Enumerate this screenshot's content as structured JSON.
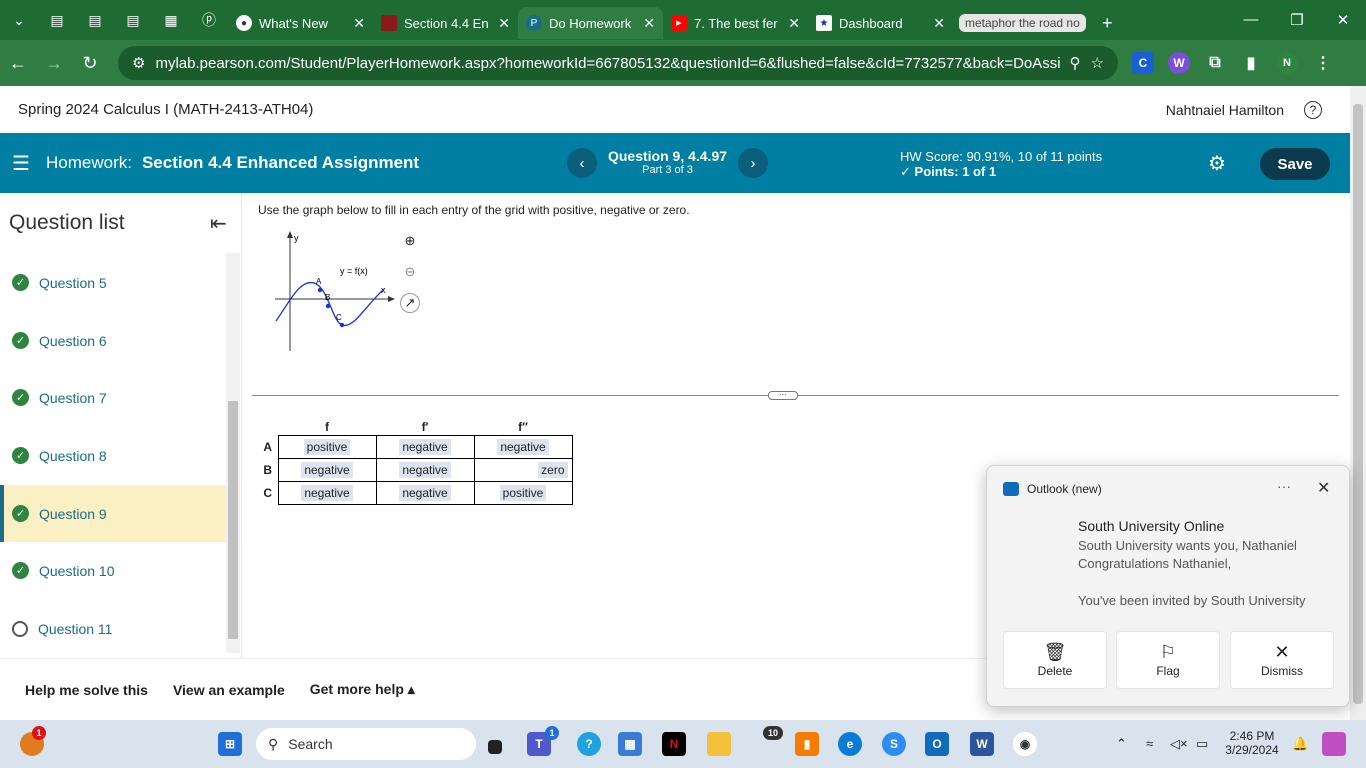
{
  "browser": {
    "tabs": [
      {
        "label": "What's New",
        "active": false
      },
      {
        "label": "Section 4.4 En",
        "active": false
      },
      {
        "label": "Do Homework",
        "active": true
      },
      {
        "label": "7. The best fer",
        "active": false
      },
      {
        "label": "Dashboard",
        "active": false
      },
      {
        "label": "metaphor the road no",
        "active": false
      }
    ],
    "new_tab": "+",
    "url": "mylab.pearson.com/Student/PlayerHomework.aspx?homeworkId=667805132&questionId=6&flushed=false&cId=7732577&back=DoAssignm...",
    "profile_initial": "N"
  },
  "course": {
    "title": "Spring 2024 Calculus I (MATH-2413-ATH04)",
    "user": "Nahtnaiel Hamilton",
    "help": "?"
  },
  "hw": {
    "label": "Homework:",
    "title": "Section 4.4 Enhanced Assignment",
    "question": "Question 9, 4.4.97",
    "part": "Part 3 of 3",
    "score": "HW Score: 90.91%, 10 of 11 points",
    "points": "Points: 1 of 1",
    "save": "Save",
    "prev": "‹",
    "next": "›"
  },
  "sidebar": {
    "title": "Question list",
    "items": [
      {
        "label": "Question 5",
        "done": true
      },
      {
        "label": "Question 6",
        "done": true
      },
      {
        "label": "Question 7",
        "done": true
      },
      {
        "label": "Question 8",
        "done": true
      },
      {
        "label": "Question 9",
        "done": true,
        "selected": true
      },
      {
        "label": "Question 10",
        "done": true
      },
      {
        "label": "Question 11",
        "done": false
      }
    ]
  },
  "question": {
    "instruction": "Use the graph below to fill in each entry of the grid with positive, negative or zero.",
    "graph": {
      "func_label": "y = f(x)",
      "x_label": "x",
      "y_label": "y",
      "points": [
        "A",
        "B",
        "C"
      ]
    },
    "grid": {
      "headers": [
        "f",
        "f′",
        "f′′"
      ],
      "rows": [
        {
          "label": "A",
          "values": [
            "positive",
            "negative",
            "negative"
          ]
        },
        {
          "label": "B",
          "values": [
            "negative",
            "negative",
            "zero"
          ]
        },
        {
          "label": "C",
          "values": [
            "negative",
            "negative",
            "positive"
          ]
        }
      ]
    }
  },
  "help_bar": {
    "solve": "Help me solve this",
    "example": "View an example",
    "more": "Get more help ▴"
  },
  "notification": {
    "app": "Outlook (new)",
    "sender": "South University Online",
    "line1": "South University wants you, Nathaniel",
    "line2": "Congratulations Nathaniel,",
    "line3": "You've been invited by South University",
    "actions": [
      "Delete",
      "Flag",
      "Dismiss"
    ]
  },
  "taskbar": {
    "search": "Search",
    "time": "2:46 PM",
    "date": "3/29/2024",
    "badge_left": "1",
    "badge_teams": "1",
    "badge_10": "10"
  },
  "colors": {
    "browser_green": "#1e6b34",
    "hw_bar": "#007fa3",
    "selected_question": "#fbf0c4",
    "check_green": "#2e8540"
  }
}
